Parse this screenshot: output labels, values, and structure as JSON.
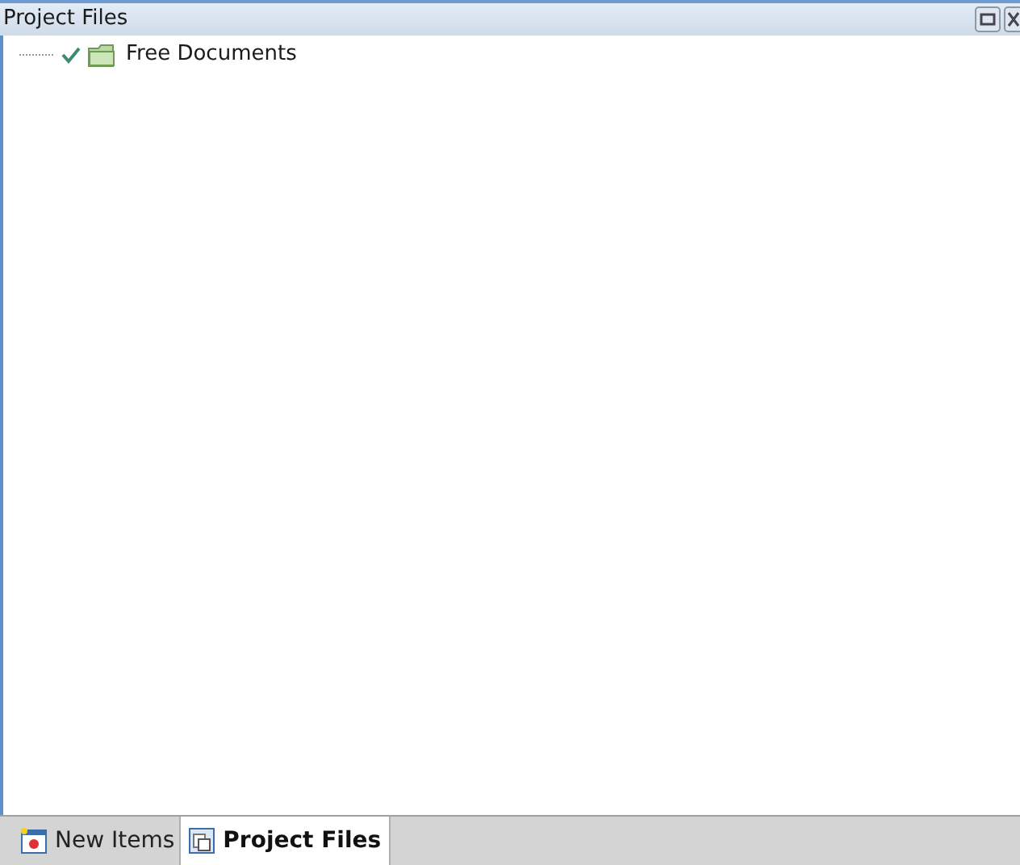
{
  "panel": {
    "title": "Project Files"
  },
  "tree": [
    {
      "label": "Free Documents",
      "checked": true
    }
  ],
  "tabs": [
    {
      "label": "New Items",
      "selected": false
    },
    {
      "label": "Project Files",
      "selected": true
    }
  ]
}
